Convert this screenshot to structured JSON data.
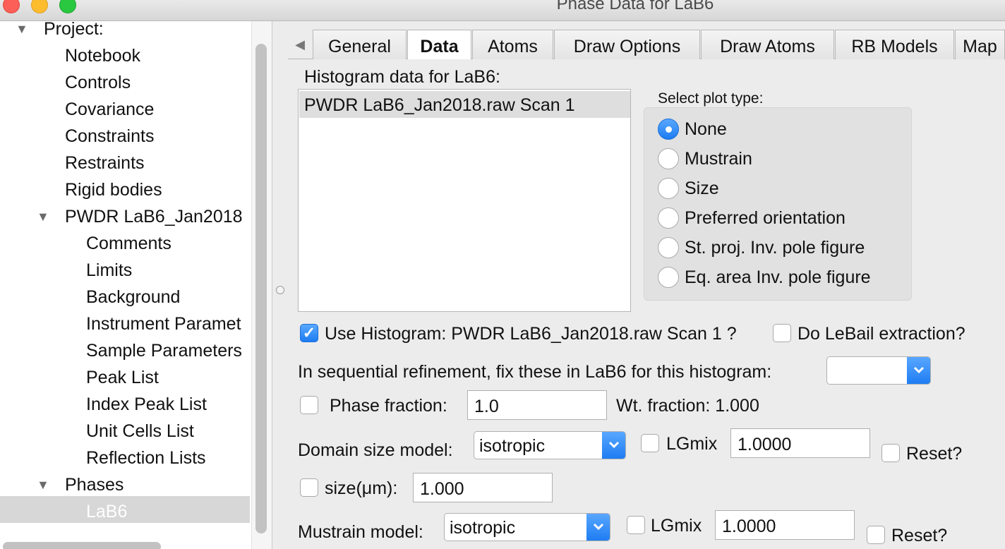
{
  "window": {
    "title": "Phase Data for LaB6"
  },
  "tree": {
    "items": [
      {
        "label": "Project:",
        "level": 0,
        "toggle": "▼"
      },
      {
        "label": "Notebook",
        "level": 1
      },
      {
        "label": "Controls",
        "level": 1
      },
      {
        "label": "Covariance",
        "level": 1
      },
      {
        "label": "Constraints",
        "level": 1
      },
      {
        "label": "Restraints",
        "level": 1
      },
      {
        "label": "Rigid bodies",
        "level": 1
      },
      {
        "label": "PWDR LaB6_Jan2018",
        "level": 1,
        "toggle": "▼"
      },
      {
        "label": "Comments",
        "level": 2
      },
      {
        "label": "Limits",
        "level": 2
      },
      {
        "label": "Background",
        "level": 2
      },
      {
        "label": "Instrument Paramet",
        "level": 2
      },
      {
        "label": "Sample Parameters",
        "level": 2
      },
      {
        "label": "Peak List",
        "level": 2
      },
      {
        "label": "Index Peak List",
        "level": 2
      },
      {
        "label": "Unit Cells List",
        "level": 2
      },
      {
        "label": "Reflection Lists",
        "level": 2
      },
      {
        "label": "Phases",
        "level": 1,
        "toggle": "▼"
      },
      {
        "label": "LaB6",
        "level": 2,
        "selected": true
      }
    ]
  },
  "tabs": [
    {
      "label": "General"
    },
    {
      "label": "Data",
      "active": true
    },
    {
      "label": "Atoms"
    },
    {
      "label": "Draw Options"
    },
    {
      "label": "Draw Atoms"
    },
    {
      "label": "RB Models"
    },
    {
      "label": "Map"
    }
  ],
  "data_tab": {
    "histogram_header": "Histogram data for LaB6:",
    "histogram_items": [
      "PWDR LaB6_Jan2018.raw Scan 1"
    ],
    "plot_type_label": "Select plot type:",
    "plot_types": [
      {
        "label": "None",
        "selected": true
      },
      {
        "label": "Mustrain",
        "selected": false
      },
      {
        "label": "Size",
        "selected": false
      },
      {
        "label": "Preferred orientation",
        "selected": false
      },
      {
        "label": "St. proj. Inv. pole figure",
        "selected": false
      },
      {
        "label": "Eq. area Inv. pole figure",
        "selected": false
      }
    ],
    "use_histogram": {
      "label": "Use Histogram: PWDR LaB6_Jan2018.raw Scan 1 ?",
      "checked": true
    },
    "lebail": {
      "label": "Do LeBail extraction?",
      "checked": false
    },
    "sequential_label": "In sequential refinement, fix these in LaB6 for this histogram:",
    "sequential_value": "",
    "phase_fraction": {
      "label": "Phase fraction:",
      "value": "1.0",
      "checked": false
    },
    "wt_fraction": "Wt. fraction: 1.000",
    "domain": {
      "label": "Domain size model:",
      "model": "isotropic",
      "lgmix_label": "LGmix",
      "lgmix_value": "1.0000",
      "reset_label": "Reset?",
      "size_label": "size(μm):",
      "size_value": "1.000"
    },
    "mustrain": {
      "label": "Mustrain model:",
      "model": "isotropic",
      "lgmix_label": "LGmix",
      "lgmix_value": "1.0000",
      "reset_label": "Reset?"
    }
  }
}
